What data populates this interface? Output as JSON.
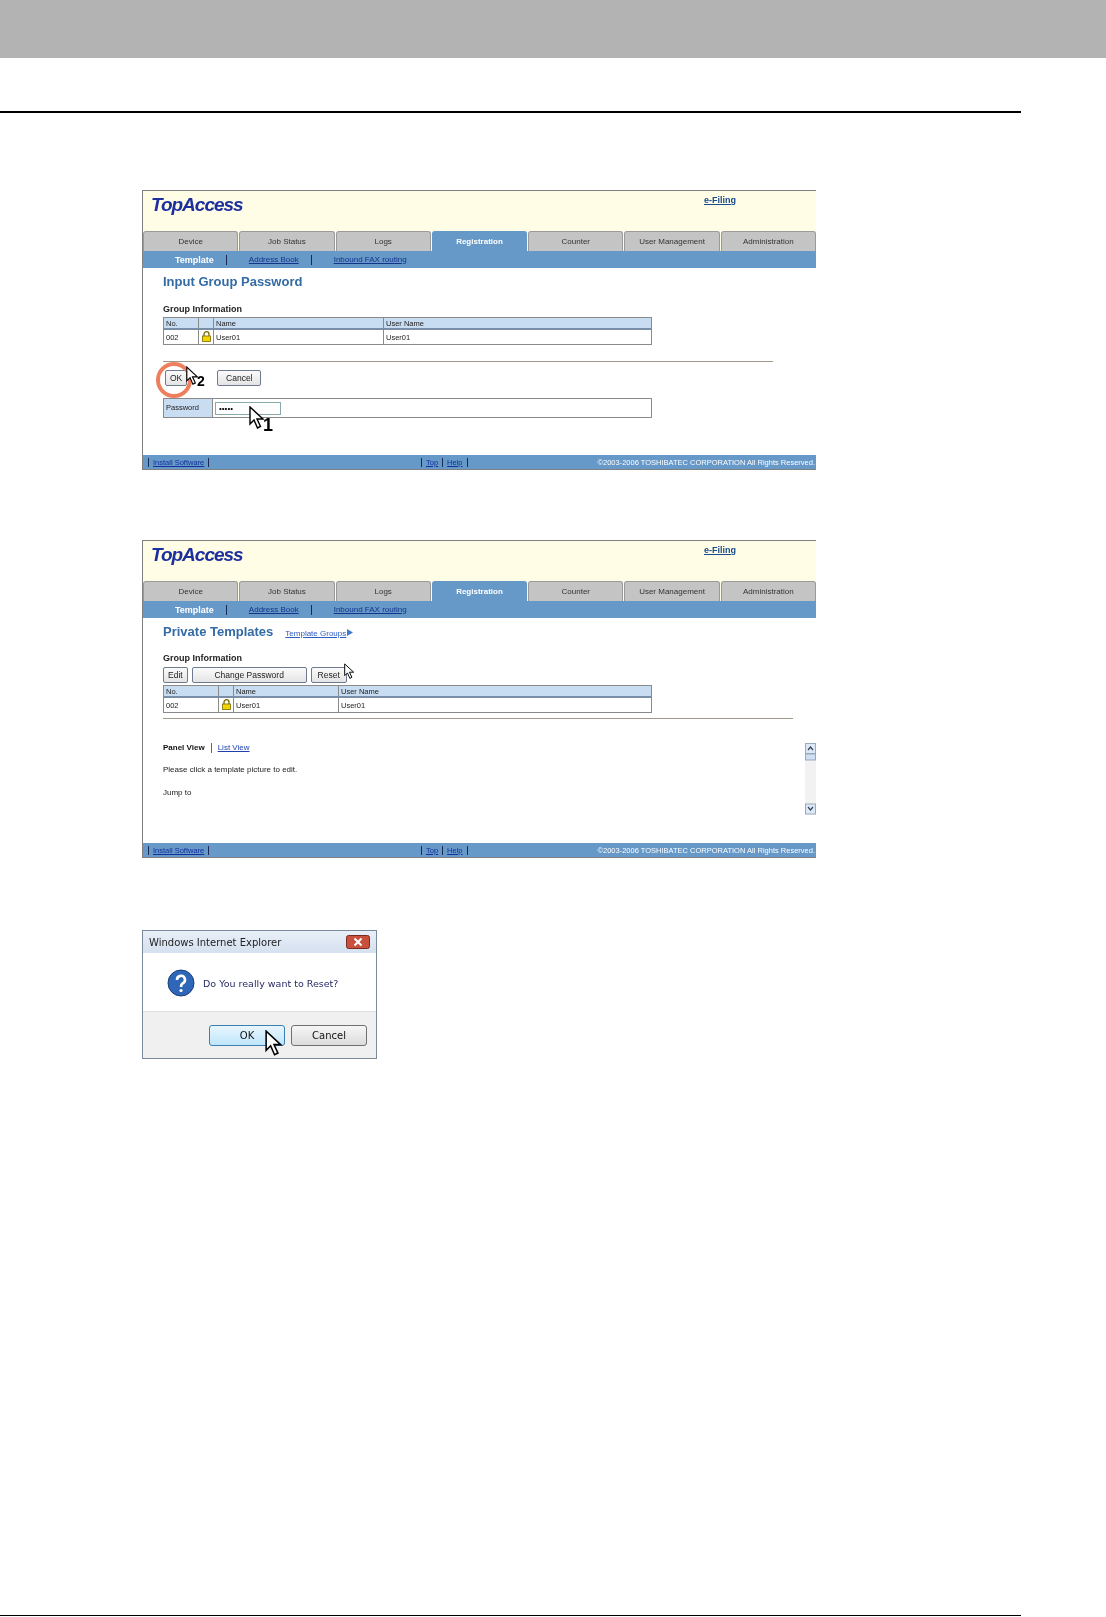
{
  "screens": [
    {
      "logo": "TopAccess",
      "header_link": "e-Filing",
      "tabs": [
        {
          "label": "Device",
          "selected": false
        },
        {
          "label": "Job Status",
          "selected": false
        },
        {
          "label": "Logs",
          "selected": false
        },
        {
          "label": "Registration",
          "selected": true
        },
        {
          "label": "Counter",
          "selected": false
        },
        {
          "label": "User Management",
          "selected": false
        },
        {
          "label": "Administration",
          "selected": false
        }
      ],
      "subnav": [
        {
          "label": "Template",
          "selected": true
        },
        {
          "label": "Address Book",
          "selected": false
        },
        {
          "label": "Inbound FAX routing",
          "selected": false
        }
      ],
      "title": "Input Group Password",
      "section": "Group Information",
      "table": {
        "columns": [
          "No.",
          "Name",
          "User Name"
        ],
        "rows": [
          {
            "no": "002",
            "locked": true,
            "name": "User01",
            "user_name": "User01"
          }
        ]
      },
      "form_buttons": [
        {
          "label": "OK",
          "highlighted": true,
          "pointer": true,
          "step": "2"
        },
        {
          "label": "Cancel",
          "highlighted": false,
          "pointer": false
        }
      ],
      "password": {
        "label": "Password",
        "value": "•••••",
        "pointer": true,
        "step": "1"
      },
      "footer": {
        "left_links": [
          "Install Software"
        ],
        "center_links": [
          "Top",
          "Help"
        ],
        "copyright": "©2003-2006 TOSHIBATEC CORPORATION All Rights Reserved."
      }
    },
    {
      "logo": "TopAccess",
      "header_link": "e-Filing",
      "tabs": [
        {
          "label": "Device",
          "selected": false
        },
        {
          "label": "Job Status",
          "selected": false
        },
        {
          "label": "Logs",
          "selected": false
        },
        {
          "label": "Registration",
          "selected": true
        },
        {
          "label": "Counter",
          "selected": false
        },
        {
          "label": "User Management",
          "selected": false
        },
        {
          "label": "Administration",
          "selected": false
        }
      ],
      "subnav": [
        {
          "label": "Template",
          "selected": true
        },
        {
          "label": "Address Book",
          "selected": false
        },
        {
          "label": "Inbound FAX routing",
          "selected": false
        }
      ],
      "title": "Private Templates",
      "title_link": "Template Groups",
      "section": "Group Information",
      "buttons": [
        {
          "label": "Edit",
          "pointer": false
        },
        {
          "label": "Change Password",
          "pointer": false
        },
        {
          "label": "Reset",
          "pointer": true
        }
      ],
      "table": {
        "columns": [
          "No.",
          "Name",
          "User Name"
        ],
        "rows": [
          {
            "no": "002",
            "locked": true,
            "name": "User01",
            "user_name": "User01"
          }
        ]
      },
      "view_links": [
        {
          "label": "Panel View",
          "selected": true
        },
        {
          "label": "List View",
          "selected": false
        }
      ],
      "instruction": "Please click a template picture to edit.",
      "jump": "Jump to",
      "footer": {
        "left_links": [
          "Install Software"
        ],
        "center_links": [
          "Top",
          "Help"
        ],
        "copyright": "©2003-2006 TOSHIBATEC CORPORATION All Rights Reserved."
      }
    }
  ],
  "dialog": {
    "title": "Windows Internet Explorer",
    "message": "Do You really want to Reset?",
    "buttons": [
      {
        "label": "OK",
        "selected": true,
        "pointer": true
      },
      {
        "label": "Cancel",
        "selected": false,
        "pointer": false
      }
    ]
  }
}
